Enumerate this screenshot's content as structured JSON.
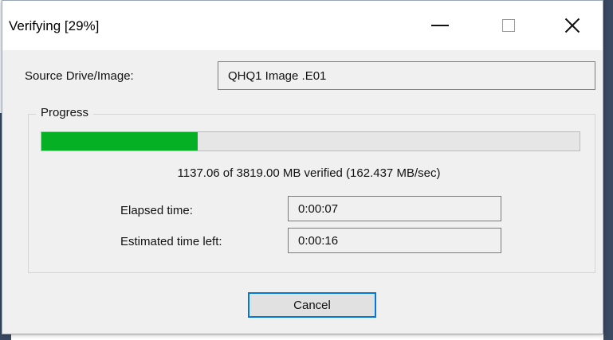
{
  "window": {
    "title": "Verifying [29%]"
  },
  "source": {
    "label": "Source Drive/Image:",
    "value": "QHQ1 Image .E01"
  },
  "progress": {
    "group_label": "Progress",
    "fraction": 0.29,
    "status_text": "1137.06 of 3819.00 MB verified (162.437 MB/sec)",
    "fill_color": "#06b025"
  },
  "elapsed": {
    "label": "Elapsed time:",
    "value": "0:00:07"
  },
  "estimated": {
    "label": "Estimated time left:",
    "value": "0:00:16"
  },
  "buttons": {
    "cancel_label": "Cancel"
  },
  "titlebar_icons": [
    "minimize-icon",
    "maximize-icon",
    "close-icon"
  ]
}
